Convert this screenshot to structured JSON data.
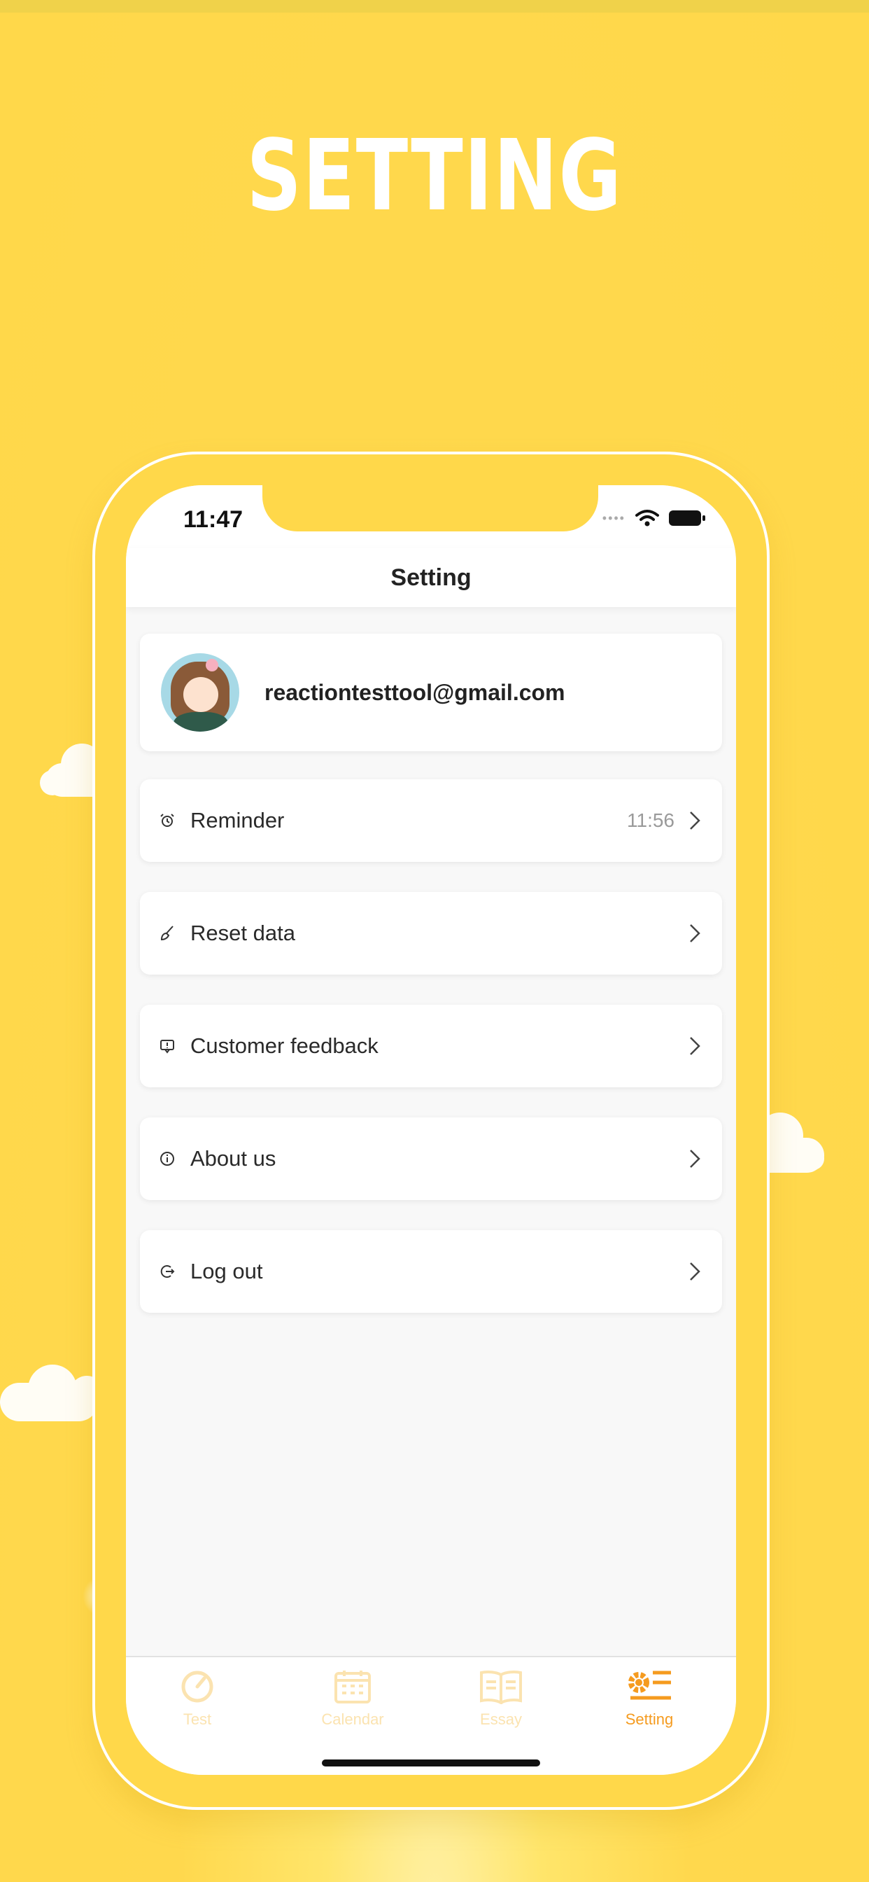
{
  "hero": {
    "title": "SETTING"
  },
  "status_bar": {
    "time": "11:47"
  },
  "navbar": {
    "title": "Setting"
  },
  "profile": {
    "email": "reactiontesttool@gmail.com"
  },
  "menu": [
    {
      "label": "Reminder",
      "value": "11:56",
      "icon": "alarm-icon"
    },
    {
      "label": "Reset data",
      "icon": "broom-icon"
    },
    {
      "label": "Customer feedback",
      "icon": "feedback-icon"
    },
    {
      "label": "About us",
      "icon": "info-icon"
    },
    {
      "label": "Log out",
      "icon": "logout-icon"
    }
  ],
  "tabs": [
    {
      "label": "Test",
      "icon": "gauge-icon",
      "active": false
    },
    {
      "label": "Calendar",
      "icon": "calendar-icon",
      "active": false
    },
    {
      "label": "Essay",
      "icon": "book-icon",
      "active": false
    },
    {
      "label": "Setting",
      "icon": "gear-icon",
      "active": true
    }
  ],
  "colors": {
    "background": "#ffd84a",
    "accent": "#f59b1f",
    "inactive_tab": "#fbe3b0"
  }
}
